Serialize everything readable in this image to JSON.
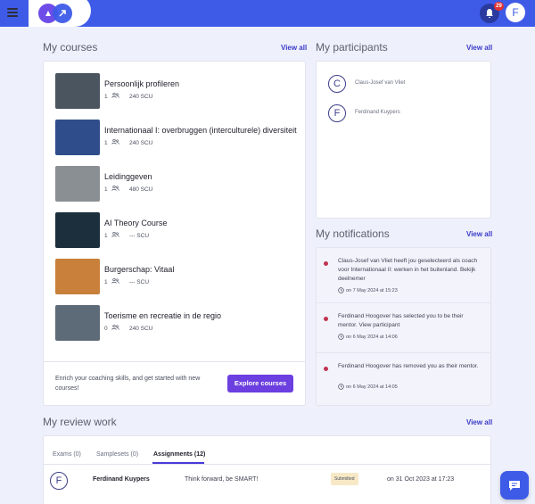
{
  "header": {
    "menu_icon": "hamburger-icon",
    "notification_count": "29",
    "avatar_letter": "F",
    "accent_color": "#3e5be8"
  },
  "courses": {
    "title": "My courses",
    "view_all": "View all",
    "items": [
      {
        "name": "Persoonlijk profileren",
        "count": "1",
        "scu": "240 SCU",
        "thumb_color": "#4a5560"
      },
      {
        "name": "Internationaal I: overbruggen (interculturele) diversiteit",
        "count": "1",
        "scu": "240 SCU",
        "thumb_color": "#2f4d8a"
      },
      {
        "name": "Leidinggeven",
        "count": "1",
        "scu": "480 SCU",
        "thumb_color": "#8a8f94"
      },
      {
        "name": "AI Theory Course",
        "count": "1",
        "scu": "--- SCU",
        "thumb_color": "#1c2f3d"
      },
      {
        "name": "Burgerschap: Vitaal",
        "count": "1",
        "scu": "--- SCU",
        "thumb_color": "#c8803a"
      },
      {
        "name": "Toerisme en recreatie in de regio",
        "count": "0",
        "scu": "240 SCU",
        "thumb_color": "#5d6a78"
      }
    ],
    "footer_text": "Enrich your coaching skills, and get started with new courses!",
    "explore_label": "Explore courses"
  },
  "participants": {
    "title": "My participants",
    "view_all": "View all",
    "items": [
      {
        "letter": "C",
        "name": "Claus-Josef van Vliet"
      },
      {
        "letter": "F",
        "name": "Ferdinand Kuypers"
      }
    ]
  },
  "notifications": {
    "title": "My notifications",
    "view_all": "View all",
    "items": [
      {
        "text": "Claus-Josef van Vliet heeft jou geselecteerd als coach voor Internationaal II: werken in het buitenland. Bekijk deelnemer",
        "time": "on 7 May 2024 at 15:23"
      },
      {
        "text": "Ferdinand Hoogover has selected you to be their mentor. View participant",
        "time": "on 6 May 2024 at 14:06"
      },
      {
        "text": "Ferdinand Hoogover has removed you as their mentor.",
        "time": "on 6 May 2024 at 14:05"
      }
    ]
  },
  "review": {
    "title": "My review work",
    "view_all": "View all",
    "tabs": [
      "Exams (0)",
      "Samplesets (0)",
      "Assignments (12)"
    ],
    "row": {
      "letter": "F",
      "name": "Ferdinand Kuypers",
      "message": "Think forward, be SMART!",
      "status": "Submitted",
      "date": "on 31 Oct 2023 at 17:23"
    }
  }
}
